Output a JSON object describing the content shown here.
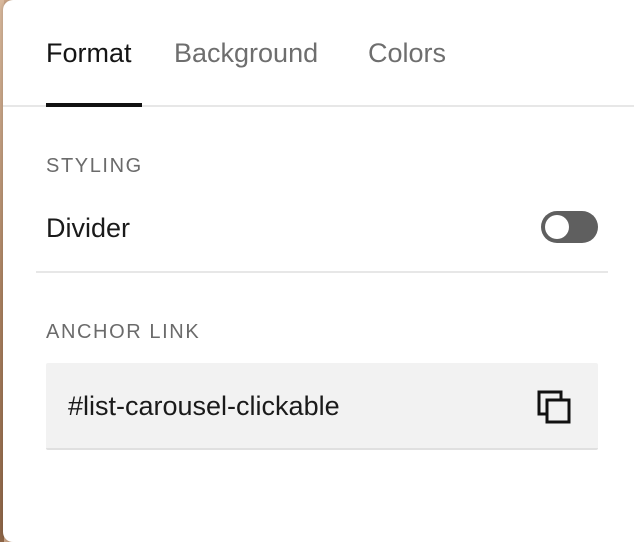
{
  "tabs": [
    {
      "label": "Format",
      "active": true
    },
    {
      "label": "Background",
      "active": false
    },
    {
      "label": "Colors",
      "active": false
    }
  ],
  "styling": {
    "section_label": "STYLING",
    "divider_label": "Divider",
    "divider_enabled": false
  },
  "anchor": {
    "section_label": "ANCHOR LINK",
    "value": "#list-carousel-clickable",
    "copy_icon": "copy-icon"
  },
  "colors": {
    "active_text": "#151515",
    "inactive_text": "#6e6e6e",
    "toggle_off": "#5f5f5f",
    "field_bg": "#f2f2f2"
  }
}
